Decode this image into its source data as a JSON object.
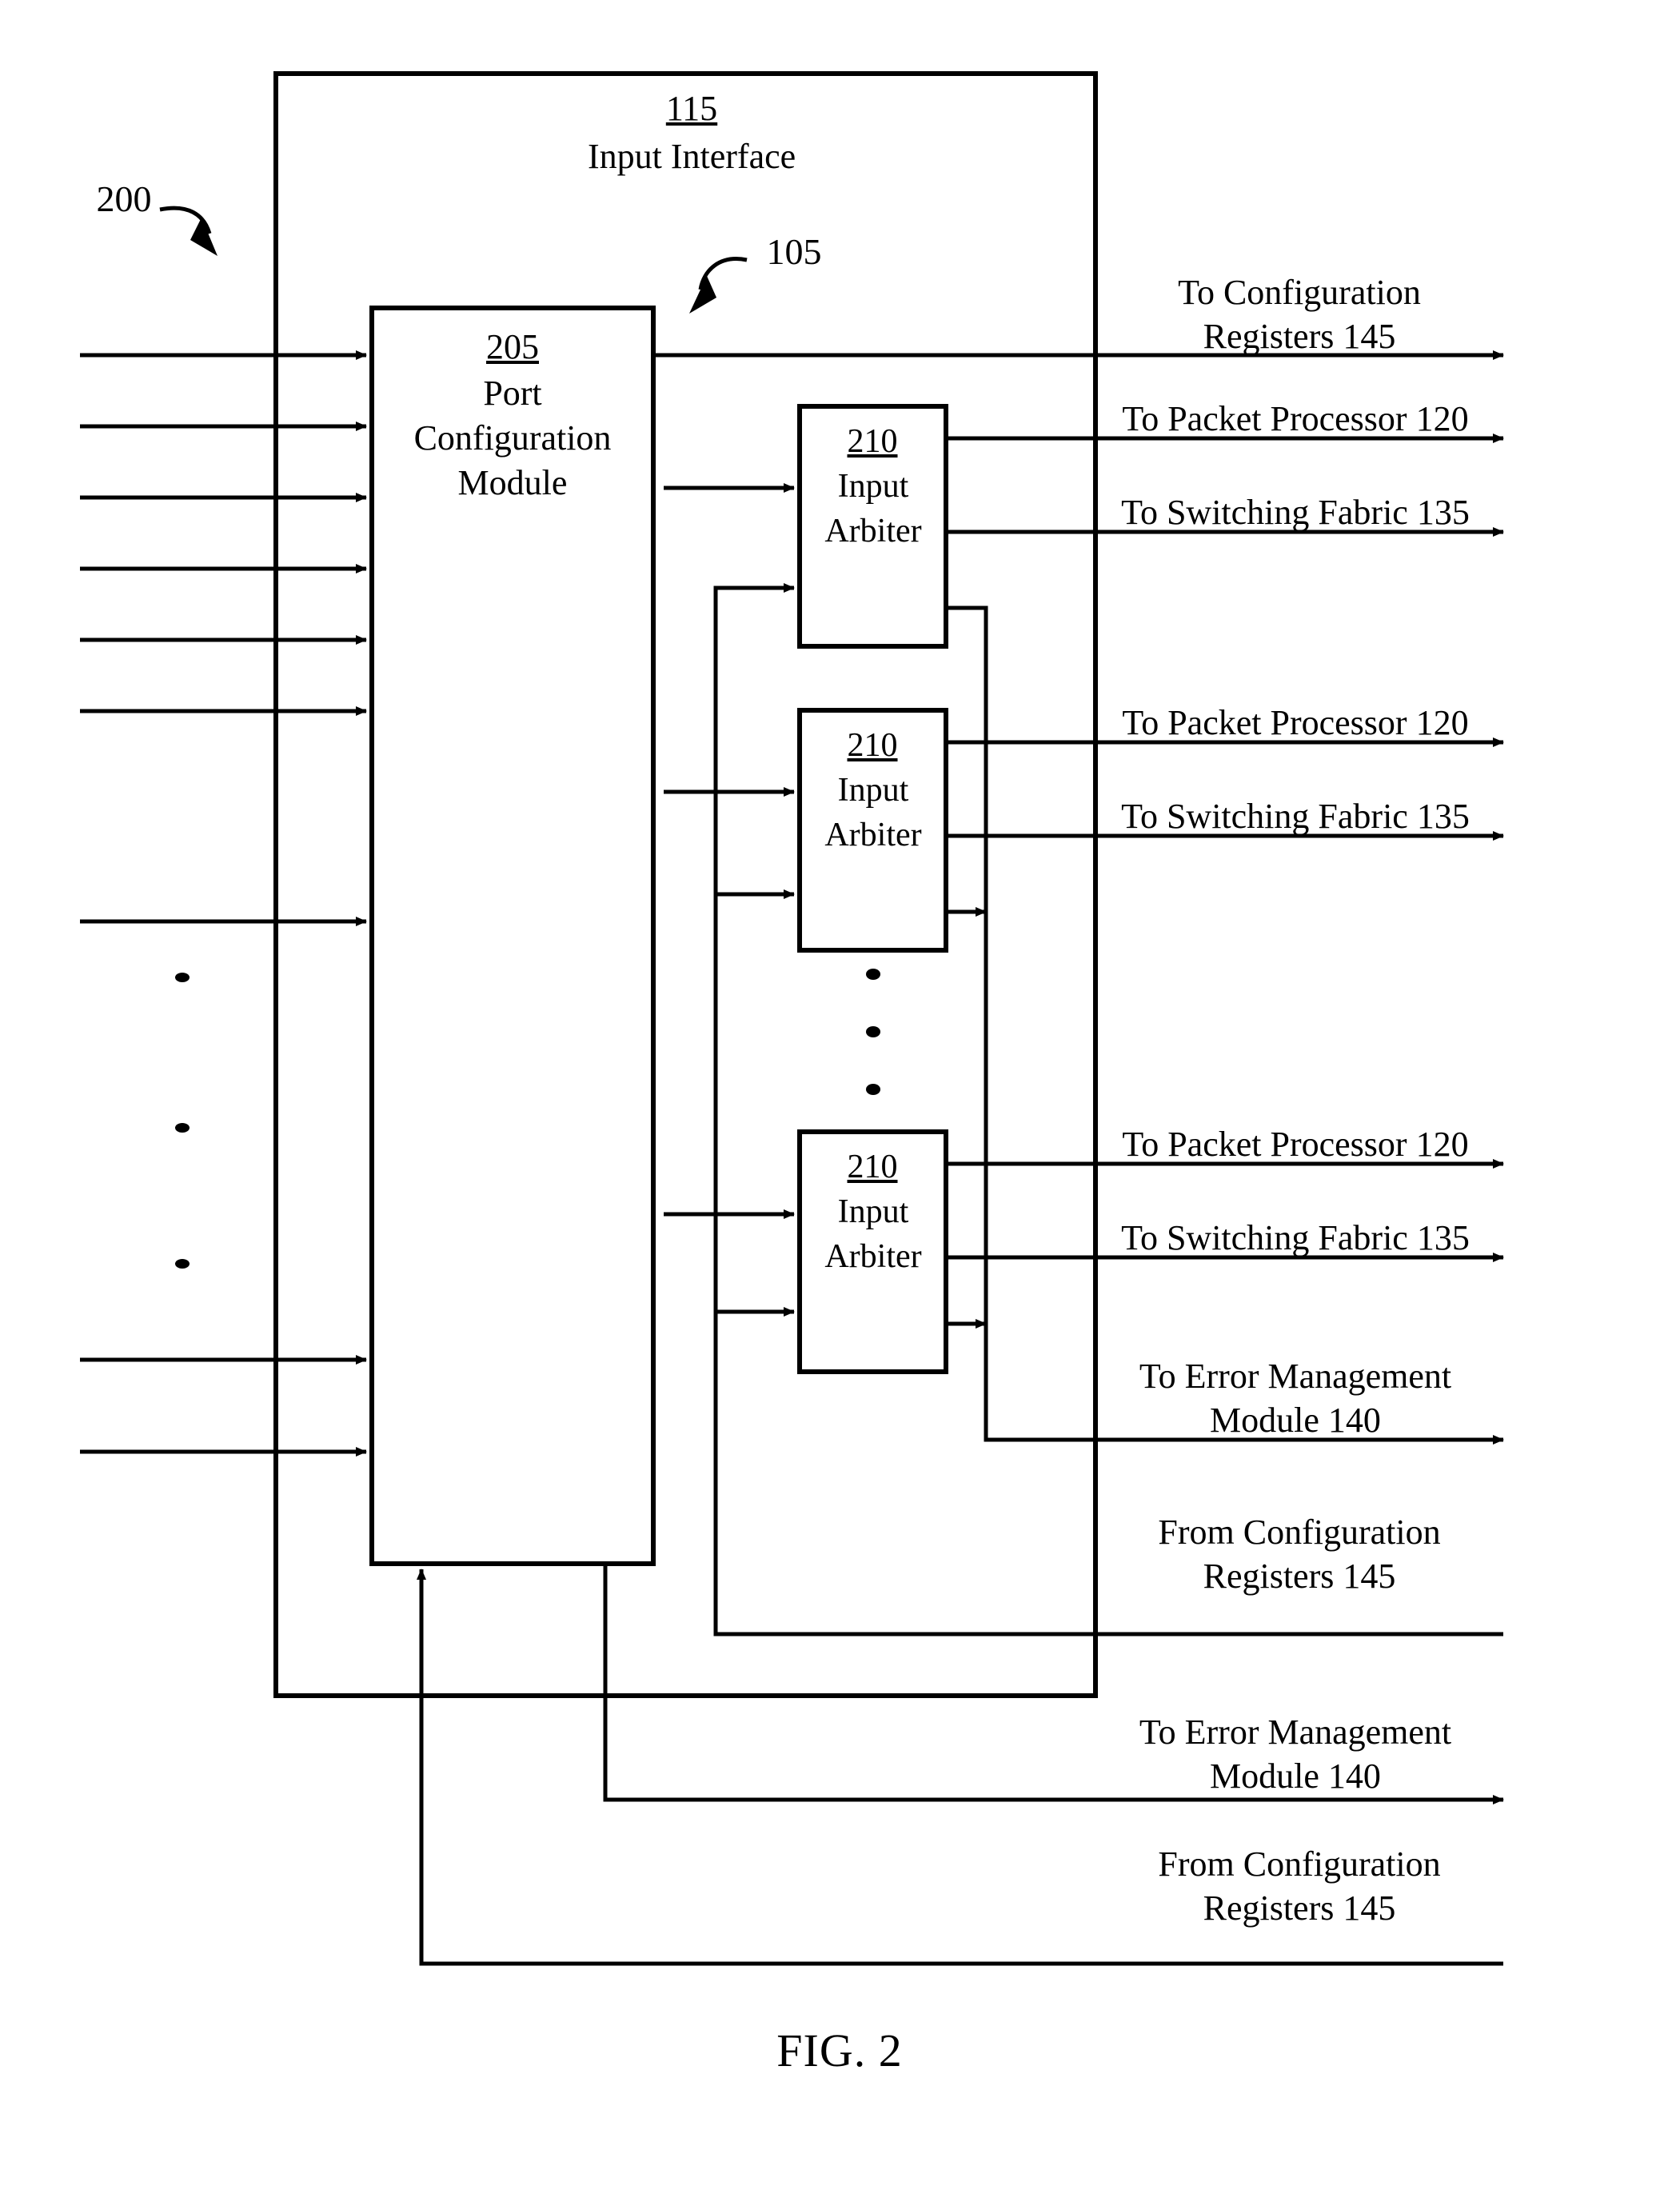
{
  "figure": {
    "caption": "FIG. 2",
    "diagram_ref": "200"
  },
  "outer_block": {
    "ref": "115",
    "title": "Input Interface"
  },
  "pointer_refs": {
    "port_config_pointer": "105",
    "diagram_pointer": "200"
  },
  "blocks": [
    {
      "ref": "205",
      "line1": "Port",
      "line2": "Configuration",
      "line3": "Module",
      "name": "port-configuration-module"
    },
    {
      "ref": "210",
      "line1": "Input",
      "line2": "Arbiter",
      "name": "input-arbiter-1"
    },
    {
      "ref": "210",
      "line1": "Input",
      "line2": "Arbiter",
      "name": "input-arbiter-2"
    },
    {
      "ref": "210",
      "line1": "Input",
      "line2": "Arbiter",
      "name": "input-arbiter-3"
    }
  ],
  "signal_labels": [
    {
      "id": "to-config-registers-145",
      "line1": "To Configuration",
      "line2": "Registers 145"
    },
    {
      "id": "to-packet-processor-120-1",
      "line1": "To Packet Processor 120",
      "line2": ""
    },
    {
      "id": "to-switching-fabric-135-1",
      "line1": "To Switching Fabric 135",
      "line2": ""
    },
    {
      "id": "to-packet-processor-120-2",
      "line1": "To Packet Processor 120",
      "line2": ""
    },
    {
      "id": "to-switching-fabric-135-2",
      "line1": "To Switching Fabric 135",
      "line2": ""
    },
    {
      "id": "to-packet-processor-120-3",
      "line1": "To Packet Processor 120",
      "line2": ""
    },
    {
      "id": "to-switching-fabric-135-3",
      "line1": "To Switching Fabric 135",
      "line2": ""
    },
    {
      "id": "to-error-management-140-1",
      "line1": "To Error Management",
      "line2": "Module 140"
    },
    {
      "id": "from-config-registers-145-1",
      "line1": "From Configuration",
      "line2": "Registers 145"
    },
    {
      "id": "to-error-management-140-2",
      "line1": "To Error Management",
      "line2": "Module 140"
    },
    {
      "id": "from-config-registers-145-2",
      "line1": "From Configuration",
      "line2": "Registers 145"
    }
  ],
  "ellipsis": {
    "left_dots": "•",
    "middle_dots": "•",
    "count": 3
  },
  "colors": {
    "stroke": "#000000",
    "background": "#ffffff"
  }
}
